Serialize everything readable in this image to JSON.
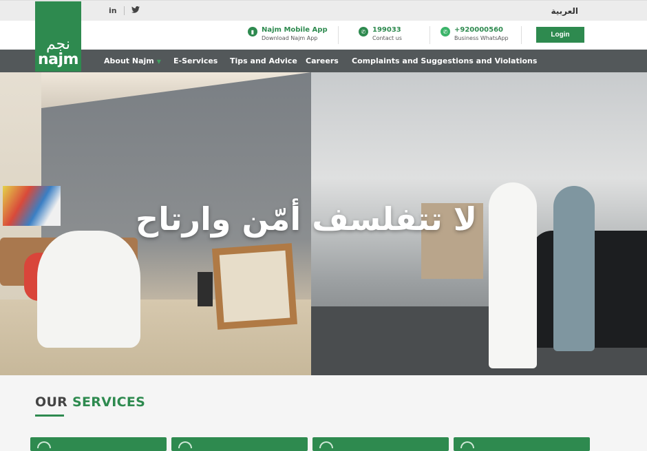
{
  "topbar": {
    "social": [
      "in",
      "twitter-icon"
    ],
    "language_label": "العربية"
  },
  "logo": {
    "arabic": "نجم",
    "english": "najm"
  },
  "header": {
    "mobile_app": {
      "title": "Najm Mobile App",
      "subtitle": "Download Najm App"
    },
    "contact": {
      "title": "199033",
      "subtitle": "Contact us"
    },
    "whatsapp": {
      "title": "+920000560",
      "subtitle": "Business WhatsApp"
    },
    "login_label": "Login"
  },
  "nav": {
    "items": [
      {
        "label": "About Najm",
        "has_dropdown": true
      },
      {
        "label": "E-Services"
      },
      {
        "label": "Tips and Advice"
      },
      {
        "label": "Careers"
      },
      {
        "label": "Complaints and Suggestions and Violations"
      }
    ]
  },
  "hero": {
    "slogan": "لا تتفلسف أمّن وارتاح"
  },
  "services": {
    "title_part1": "OUR",
    "title_part2": "SERVICES"
  },
  "colors": {
    "brand_green": "#2e8a4f",
    "nav_bg": "#53585a"
  }
}
